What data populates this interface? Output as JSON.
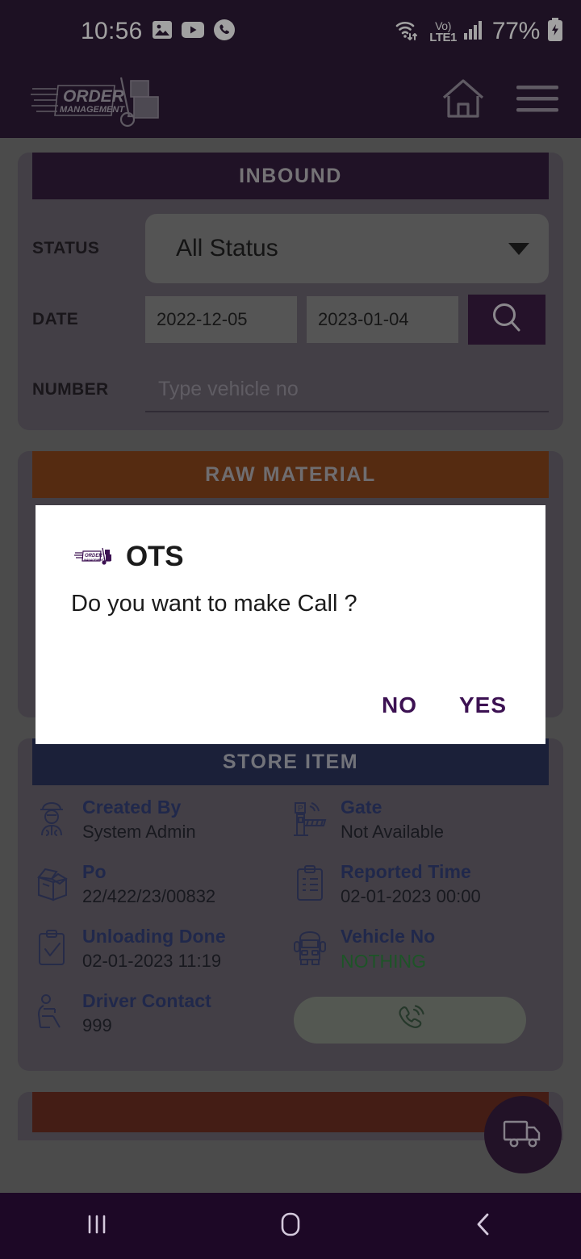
{
  "status_bar": {
    "time": "10:56",
    "left_icons": [
      "gallery-icon",
      "youtube-icon",
      "phone-call-icon"
    ],
    "network_top": "Vo)",
    "network_bottom": "LTE1",
    "battery_text": "77%",
    "right_icons": [
      "wifi-icon",
      "signal-bars-icon",
      "battery-charging-icon"
    ]
  },
  "app_header": {
    "logo_line1": "ORDER",
    "logo_line2": "MANAGEMENT",
    "home_icon": "home-icon",
    "menu_icon": "hamburger-menu-icon"
  },
  "inbound": {
    "title": "INBOUND",
    "status_label": "STATUS",
    "status_value": "All Status",
    "date_label": "DATE",
    "date_from": "2022-12-05",
    "date_to": "2023-01-04",
    "search_icon": "search-icon",
    "number_label": "NUMBER",
    "number_value": "",
    "number_placeholder": "Type vehicle no"
  },
  "raw_material": {
    "title": "RAW MATERIAL"
  },
  "store_item": {
    "title": "STORE ITEM",
    "fields": [
      {
        "label": "Created By",
        "value": "System Admin",
        "icon": "officer-icon"
      },
      {
        "label": "Gate",
        "value": "Not Available",
        "icon": "gate-barrier-icon"
      },
      {
        "label": "Po",
        "value": "22/422/23/00832",
        "icon": "open-box-icon"
      },
      {
        "label": "Reported Time",
        "value": "02-01-2023 00:00",
        "icon": "clipboard-lines-icon"
      },
      {
        "label": "Unloading Done",
        "value": "02-01-2023 11:19",
        "icon": "clipboard-check-icon"
      },
      {
        "label": "Vehicle No",
        "value": "NOTHING",
        "icon": "truck-front-icon"
      },
      {
        "label": "Driver Contact",
        "value": "999",
        "icon": "driver-icon"
      }
    ],
    "call_button_icon": "phone-ring-icon"
  },
  "fab": {
    "icon": "delivery-truck-icon"
  },
  "dialog": {
    "app_icon": "order-management-mini-logo",
    "title": "OTS",
    "message": "Do you want to make Call ?",
    "no_label": "NO",
    "yes_label": "YES"
  },
  "nav_bar": {
    "recents_icon": "recents-icon",
    "home_icon": "home-square-icon",
    "back_icon": "back-chevron-icon"
  },
  "colors": {
    "header_purple": "#1d0826",
    "inbound_header": "#220a2c",
    "raw_header": "#7d3408",
    "store_header": "#19214d",
    "accent_purple": "#3c1152",
    "label_navy": "#22306b",
    "value_green": "#1d7a2e",
    "page_bg": "#6b6b6b",
    "card_bg": "#5d5663"
  }
}
